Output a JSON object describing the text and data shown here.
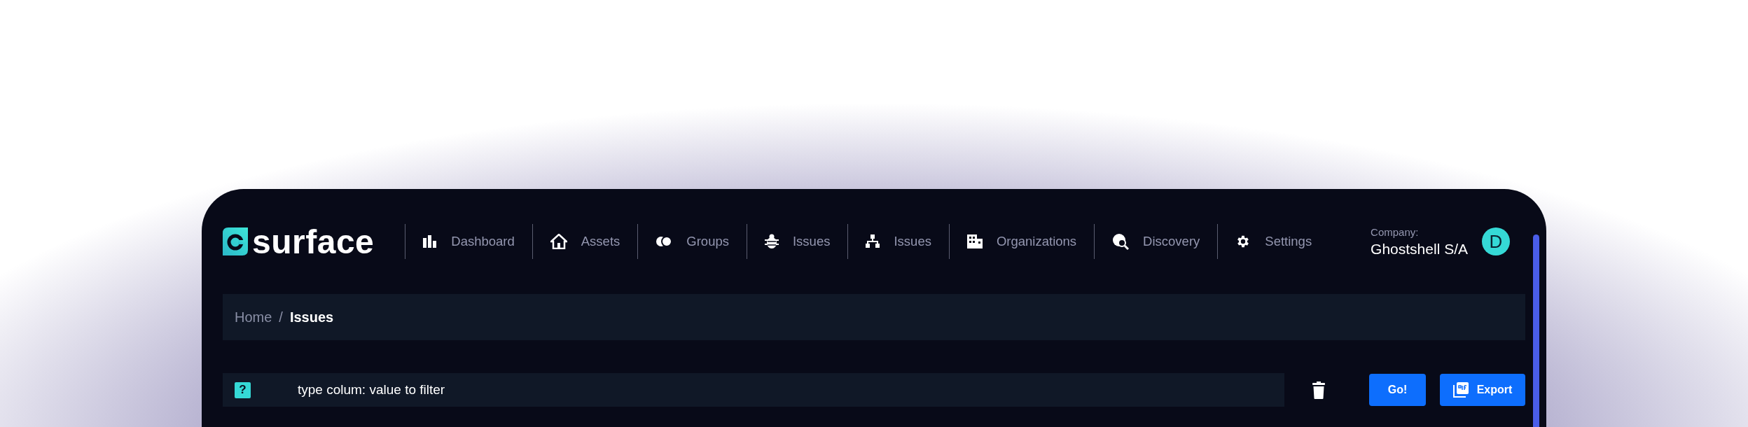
{
  "logo": {
    "text": "surface"
  },
  "nav": [
    {
      "label": "Dashboard"
    },
    {
      "label": "Assets"
    },
    {
      "label": "Groups"
    },
    {
      "label": "Issues"
    },
    {
      "label": "Issues"
    },
    {
      "label": "Organizations"
    },
    {
      "label": "Discovery"
    },
    {
      "label": "Settings"
    }
  ],
  "company": {
    "caption": "Company:",
    "name": "Ghostshell S/A"
  },
  "avatar": {
    "initial": "D"
  },
  "breadcrumb": [
    {
      "label": "Home",
      "current": false
    },
    {
      "label": "Issues",
      "current": true
    }
  ],
  "breadcrumb_separator": "/",
  "filter": {
    "help": "?",
    "value": "type colum: value to filter"
  },
  "buttons": [
    {
      "label": "Go!",
      "kind": "submit"
    },
    {
      "label": "Export",
      "kind": "export"
    }
  ]
}
